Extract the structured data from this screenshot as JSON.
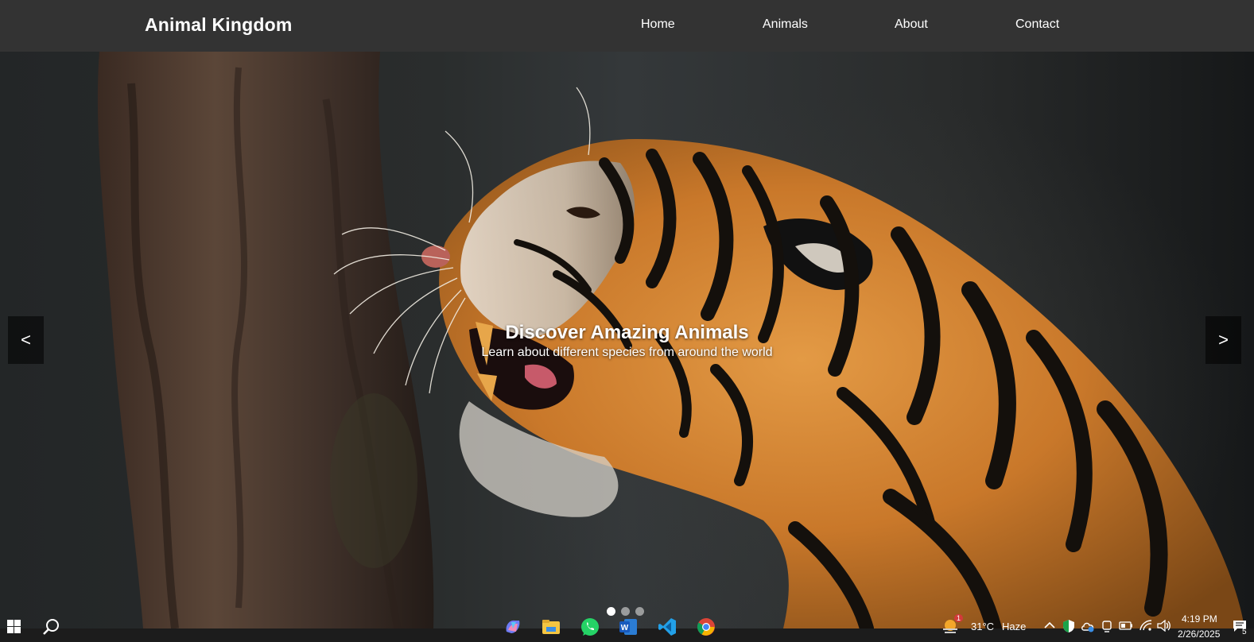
{
  "navbar": {
    "brand": "Animal Kingdom",
    "links": [
      "Home",
      "Animals",
      "About",
      "Contact"
    ]
  },
  "hero": {
    "title": "Discover Amazing Animals",
    "subtitle": "Learn about different species from around the world",
    "prev_label": "<",
    "next_label": ">",
    "slide_count": 3,
    "active_slide": 1
  },
  "taskbar": {
    "weather_temp": "31°C",
    "weather_condition": "Haze",
    "weather_badge": "1",
    "time": "4:19 PM",
    "date": "2/26/2025",
    "notification_count": "5",
    "pinned_apps": [
      "copilot-icon",
      "file-explorer-icon",
      "whatsapp-icon",
      "word-icon",
      "vscode-icon",
      "chrome-icon"
    ]
  },
  "colors": {
    "navbar_bg": "#333333",
    "tiger_orange": "#d8842a",
    "text": "#ffffff"
  }
}
